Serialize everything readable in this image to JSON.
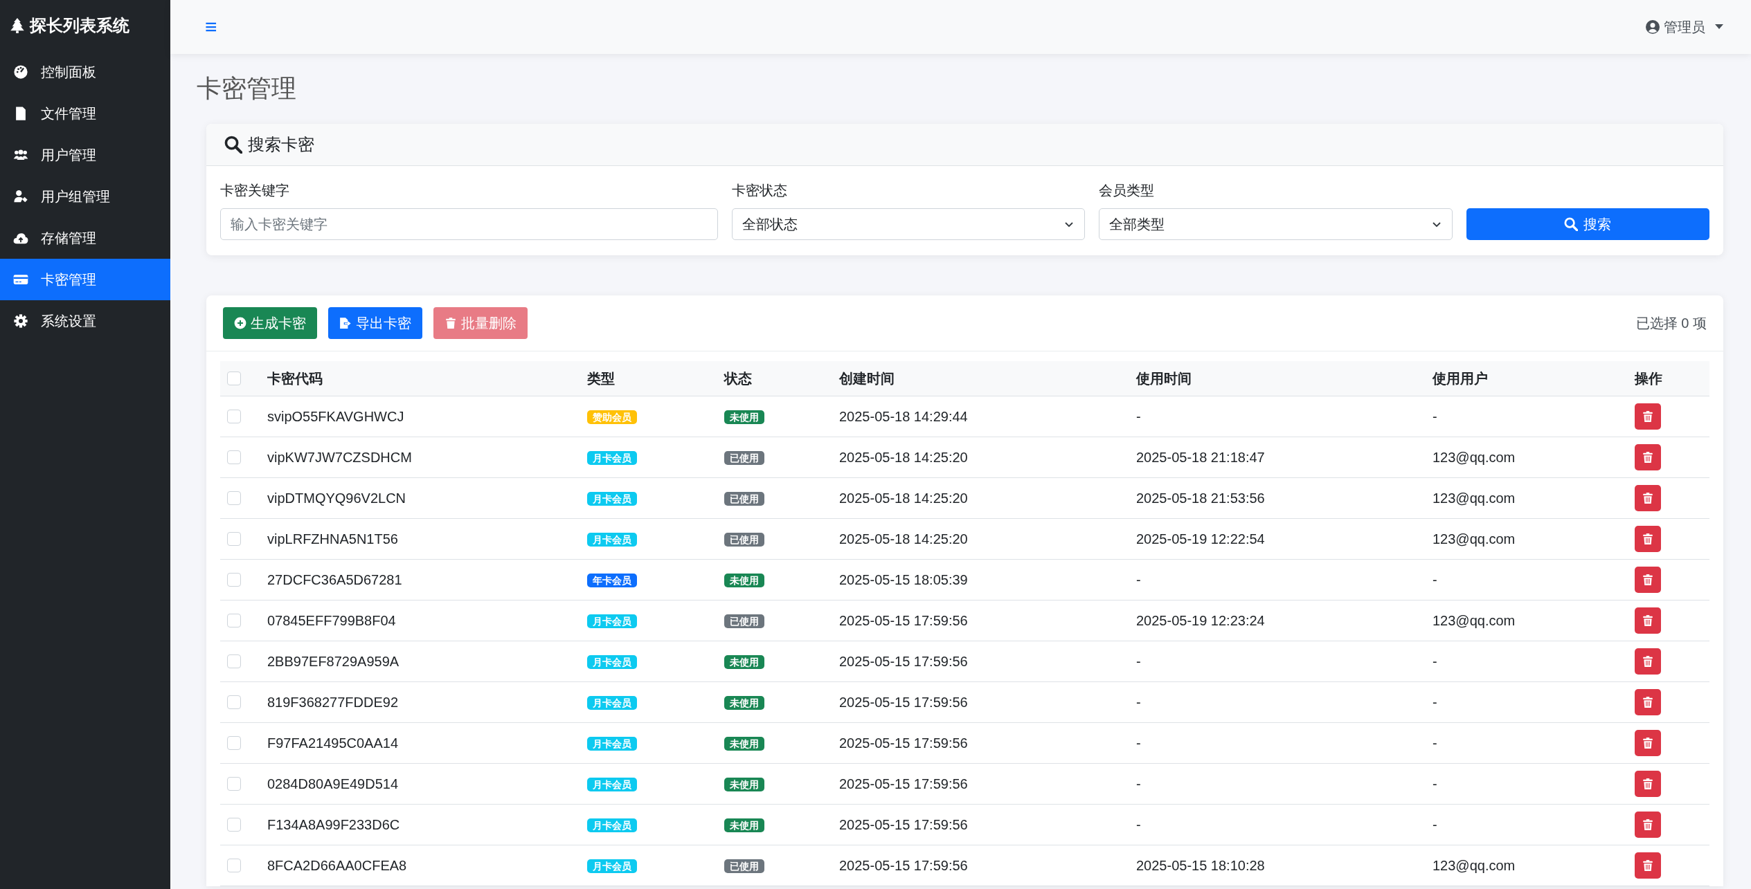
{
  "sidebar": {
    "brand": "探长列表系统",
    "items": [
      {
        "label": "控制面板",
        "selected": false
      },
      {
        "label": "文件管理",
        "selected": false
      },
      {
        "label": "用户管理",
        "selected": false
      },
      {
        "label": "用户组管理",
        "selected": false
      },
      {
        "label": "存储管理",
        "selected": false
      },
      {
        "label": "卡密管理",
        "selected": true
      },
      {
        "label": "系统设置",
        "selected": false
      }
    ]
  },
  "topbar": {
    "menu_icon": "≡",
    "user": "管理员"
  },
  "page_title": "卡密管理",
  "search": {
    "title": "搜索卡密",
    "fields": [
      {
        "kind": "input",
        "label": "卡密关键字",
        "placeholder": "输入卡密关键字"
      },
      {
        "kind": "select",
        "label": "卡密状态",
        "value": "全部状态"
      },
      {
        "kind": "select",
        "label": "会员类型",
        "value": "全部类型"
      }
    ],
    "button": "搜索"
  },
  "toolbar": {
    "buttons": [
      {
        "kind": "generate",
        "label": "生成卡密",
        "disabled": false
      },
      {
        "kind": "export",
        "label": "导出卡密",
        "disabled": false
      },
      {
        "kind": "delete",
        "label": "批量删除",
        "disabled": true
      }
    ],
    "selected_count": "已选择 0 项"
  },
  "table": {
    "select_all_checked": false,
    "columns": [
      "卡密代码",
      "类型",
      "状态",
      "创建时间",
      "使用时间",
      "使用用户",
      "操作"
    ],
    "rows": [
      {
        "checked": false,
        "code": "svipO55FKAVGHWCJ",
        "type": {
          "label": "赞助会员",
          "color": "#ffc107"
        },
        "status": {
          "label": "未使用",
          "color": "#198754"
        },
        "created": "2025-05-18 14:29:44",
        "used": "-",
        "user": "-"
      },
      {
        "checked": false,
        "code": "vipKW7JW7CZSDHCM",
        "type": {
          "label": "月卡会员",
          "color": "#0dcaf0"
        },
        "status": {
          "label": "已使用",
          "color": "#6c757d"
        },
        "created": "2025-05-18 14:25:20",
        "used": "2025-05-18 21:18:47",
        "user": "123@qq.com"
      },
      {
        "checked": false,
        "code": "vipDTMQYQ96V2LCN",
        "type": {
          "label": "月卡会员",
          "color": "#0dcaf0"
        },
        "status": {
          "label": "已使用",
          "color": "#6c757d"
        },
        "created": "2025-05-18 14:25:20",
        "used": "2025-05-18 21:53:56",
        "user": "123@qq.com"
      },
      {
        "checked": false,
        "code": "vipLRFZHNA5N1T56",
        "type": {
          "label": "月卡会员",
          "color": "#0dcaf0"
        },
        "status": {
          "label": "已使用",
          "color": "#6c757d"
        },
        "created": "2025-05-18 14:25:20",
        "used": "2025-05-19 12:22:54",
        "user": "123@qq.com"
      },
      {
        "checked": false,
        "code": "27DCFC36A5D67281",
        "type": {
          "label": "年卡会员",
          "color": "#0d6efd"
        },
        "status": {
          "label": "未使用",
          "color": "#198754"
        },
        "created": "2025-05-15 18:05:39",
        "used": "-",
        "user": "-"
      },
      {
        "checked": false,
        "code": "07845EFF799B8F04",
        "type": {
          "label": "月卡会员",
          "color": "#0dcaf0"
        },
        "status": {
          "label": "已使用",
          "color": "#6c757d"
        },
        "created": "2025-05-15 17:59:56",
        "used": "2025-05-19 12:23:24",
        "user": "123@qq.com"
      },
      {
        "checked": false,
        "code": "2BB97EF8729A959A",
        "type": {
          "label": "月卡会员",
          "color": "#0dcaf0"
        },
        "status": {
          "label": "未使用",
          "color": "#198754"
        },
        "created": "2025-05-15 17:59:56",
        "used": "-",
        "user": "-"
      },
      {
        "checked": false,
        "code": "819F368277FDDE92",
        "type": {
          "label": "月卡会员",
          "color": "#0dcaf0"
        },
        "status": {
          "label": "未使用",
          "color": "#198754"
        },
        "created": "2025-05-15 17:59:56",
        "used": "-",
        "user": "-"
      },
      {
        "checked": false,
        "code": "F97FA21495C0AA14",
        "type": {
          "label": "月卡会员",
          "color": "#0dcaf0"
        },
        "status": {
          "label": "未使用",
          "color": "#198754"
        },
        "created": "2025-05-15 17:59:56",
        "used": "-",
        "user": "-"
      },
      {
        "checked": false,
        "code": "0284D80A9E49D514",
        "type": {
          "label": "月卡会员",
          "color": "#0dcaf0"
        },
        "status": {
          "label": "未使用",
          "color": "#198754"
        },
        "created": "2025-05-15 17:59:56",
        "used": "-",
        "user": "-"
      },
      {
        "checked": false,
        "code": "F134A8A99F233D6C",
        "type": {
          "label": "月卡会员",
          "color": "#0dcaf0"
        },
        "status": {
          "label": "未使用",
          "color": "#198754"
        },
        "created": "2025-05-15 17:59:56",
        "used": "-",
        "user": "-"
      },
      {
        "checked": false,
        "code": "8FCA2D66AA0CFEA8",
        "type": {
          "label": "月卡会员",
          "color": "#0dcaf0"
        },
        "status": {
          "label": "已使用",
          "color": "#6c757d"
        },
        "created": "2025-05-15 17:59:56",
        "used": "2025-05-15 18:10:28",
        "user": "123@qq.com"
      }
    ]
  }
}
